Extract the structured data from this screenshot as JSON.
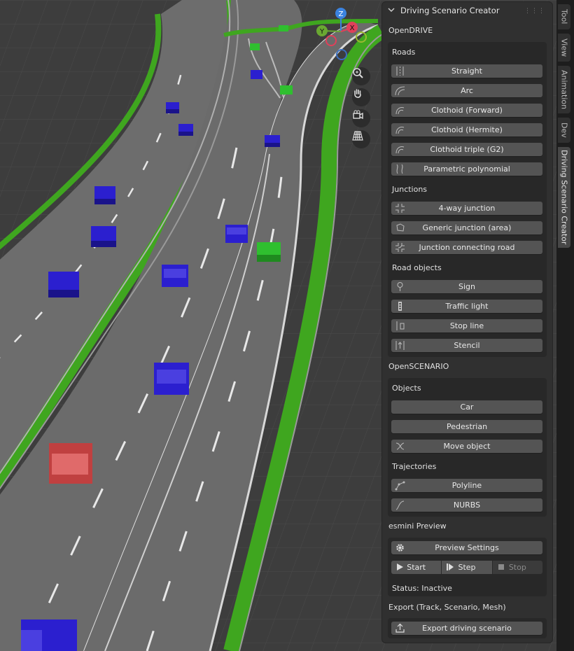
{
  "gizmo": {
    "z": "Z",
    "y": "Y",
    "x": "X"
  },
  "panel": {
    "title": "Driving Scenario Creator",
    "opendrive": {
      "title": "OpenDRIVE",
      "roads": {
        "label": "Roads",
        "items": [
          "Straight",
          "Arc",
          "Clothoid (Forward)",
          "Clothoid (Hermite)",
          "Clothoid triple (G2)",
          "Parametric polynomial"
        ]
      },
      "junctions": {
        "label": "Junctions",
        "items": [
          "4-way junction",
          "Generic junction (area)",
          "Junction connecting road"
        ]
      },
      "road_objects": {
        "label": "Road objects",
        "items": [
          "Sign",
          "Traffic light",
          "Stop line",
          "Stencil"
        ]
      }
    },
    "openscenario": {
      "title": "OpenSCENARIO",
      "objects": {
        "label": "Objects",
        "items": [
          "Car",
          "Pedestrian",
          "Move object"
        ]
      },
      "trajectories": {
        "label": "Trajectories",
        "items": [
          "Polyline",
          "NURBS"
        ]
      }
    },
    "esmini": {
      "title": "esmini Preview",
      "settings_label": "Preview Settings",
      "start_label": "Start",
      "step_label": "Step",
      "stop_label": "Stop",
      "status": "Status: Inactive"
    },
    "export": {
      "title": "Export (Track, Scenario, Mesh)",
      "button_label": "Export driving scenario"
    }
  },
  "tabs": [
    "Tool",
    "View",
    "Animation",
    "Dev",
    "Driving Scenario Creator"
  ],
  "colors": {
    "road": "#6b6b6b",
    "shoulder": "#3fa61f",
    "car_blue": "#2b1fcf",
    "car_green": "#2fbf2f",
    "car_red": "#c04040",
    "panel": "#303030",
    "button": "#545454"
  }
}
